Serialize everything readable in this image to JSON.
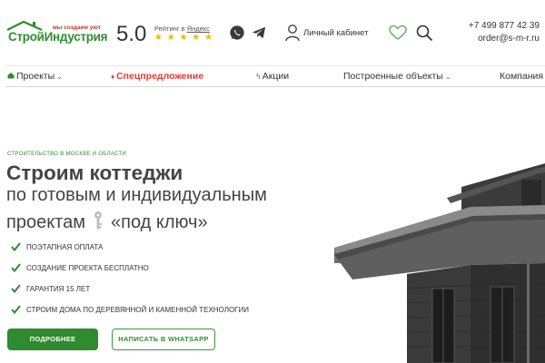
{
  "header": {
    "logo": {
      "tagline": "мы создаем уют",
      "name": "СтройИндустрия"
    },
    "rating": {
      "value": "5.0",
      "label_prefix": "Рейтинг в ",
      "label_source": "Яндекс",
      "stars": "★ ★ ★ ★ ★",
      "star_color": "#f2b705"
    },
    "messengers": [
      {
        "name": "whatsapp-icon"
      },
      {
        "name": "telegram-icon"
      }
    ],
    "account_label": "Личный кабинет",
    "favorites_icon": "heart-icon",
    "search_icon": "search-icon",
    "phone": "+7 499 877 42 39",
    "email": "order@s-m-r.ru"
  },
  "nav": {
    "items": [
      {
        "label": "Проекты",
        "icon": "house-icon",
        "has_dropdown": true
      },
      {
        "label": "Спецпредложение",
        "icon": "fire-icon",
        "highlight": true
      },
      {
        "label": "Акции",
        "icon": "lightning-icon"
      },
      {
        "label": "Построенные объекты",
        "has_dropdown": true
      },
      {
        "label": "Компания"
      }
    ]
  },
  "hero": {
    "eyebrow": "СТРОИТЕЛЬСТВО В МОСКВЕ И ОБЛАСТИ",
    "title": "Строим коттеджи",
    "subtitle_line1": "по готовым и индивидуальным",
    "subtitle_line2_start": "проектам",
    "subtitle_line2_end": "«под ключ»",
    "features": [
      "ПОЭТАПНАЯ ОПЛАТА",
      "СОЗДАНИЕ ПРОЕКТА БЕСПЛАТНО",
      "ГАРАНТИЯ 15 ЛЕТ",
      "СТРОИМ ДОМА ПО ДЕРЕВЯННОЙ И КАМЕННОЙ ТЕХНОЛОГИИ"
    ],
    "primary_button": "ПОДРОБНЕЕ",
    "secondary_button": "НАПИСАТЬ В WHATSAPP"
  },
  "colors": {
    "brand_green": "#2e8b2e",
    "accent_red": "#e53935",
    "text": "#444444"
  }
}
